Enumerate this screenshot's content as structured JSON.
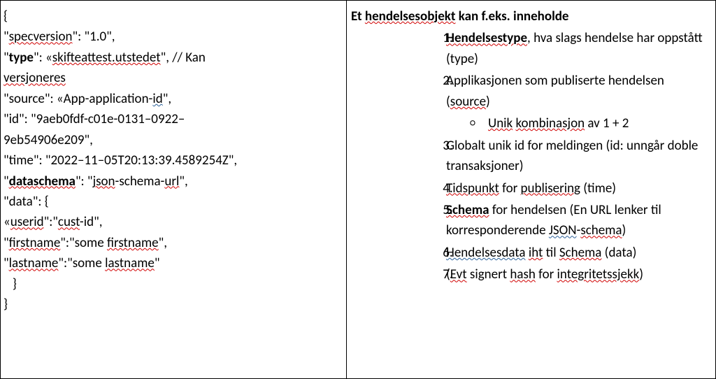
{
  "left": {
    "l1": "{",
    "l2_a": "\"",
    "l2_b": "specversion",
    "l2_c": "\": \"1.0\",",
    "l3_a": "\"",
    "l3_b": "type",
    "l3_c": "\": «",
    "l3_d": "skifteattest.utstedet",
    "l3_e": "\", // Kan",
    "l4_a": "versjoneres",
    "l5_a": "\"source\": «App-application-",
    "l5_b": "id",
    "l5_c": "\",",
    "l6_a": "\"id\": \"9aeb0fdf-c01e-0131–0922–",
    "l7_a": "9eb54906e209\",",
    "l8_a": "\"time\": \"2022–11–05T20:13:39.4589254Z\",",
    "l9_a": "\"",
    "l9_b": "dataschema",
    "l9_c": "\": \"",
    "l9_d": "json",
    "l9_e": "-schema-",
    "l9_f": "url",
    "l9_g": "\",",
    "l10_a": "\"data\": {",
    "l11_a": "«",
    "l11_b": "userid",
    "l11_c": "\":\"",
    "l11_d": "cust",
    "l11_e": "-id\",",
    "l12_a": "\"",
    "l12_b": "firstname",
    "l12_c": "\":\"some ",
    "l12_d": "firstname",
    "l12_e": "\",",
    "l13_a": "\"",
    "l13_b": "lastname",
    "l13_c": "\":\"some ",
    "l13_d": "lastname",
    "l13_e": "\"",
    "l14": "   }",
    "l15": "}"
  },
  "right": {
    "header_a": "Et ",
    "header_b": "hendelsesobjekt",
    "header_c": " kan f.eks. inneholde",
    "i1_a": "Hendelsestype",
    "i1_b": ", hva slags hendelse har oppstått (type)",
    "i2_a": "Applikasjonen som publiserte hendelsen (",
    "i2_b": "source",
    "i2_c": ")",
    "i2s_a": "Unik",
    "i2s_b": " ",
    "i2s_c": "kombinasjon",
    "i2s_d": " av 1 + 2",
    "i3_a": "Globalt unik id for meldingen (id: unngår doble transaksjoner)",
    "i4_a": "Tidspunkt",
    "i4_b": " for ",
    "i4_c": "publisering",
    "i4_d": " (time)",
    "i5_a": "Schema",
    "i5_b": " for hendelsen (En URL lenker til korresponderende ",
    "i5_c": "JSON",
    "i5_d": "-",
    "i5_e": "schema",
    "i5_f": ")",
    "i6_a": "Hendelsesdata",
    "i6_b": " ",
    "i6_c": "iht",
    "i6_d": " til ",
    "i6_e": "Schema",
    "i6_f": " (data)",
    "i7_a": "(",
    "i7_b": "Evt",
    "i7_c": " signert ",
    "i7_d": "hash",
    "i7_e": " for ",
    "i7_f": "integritetssjekk",
    "i7_g": ")"
  }
}
